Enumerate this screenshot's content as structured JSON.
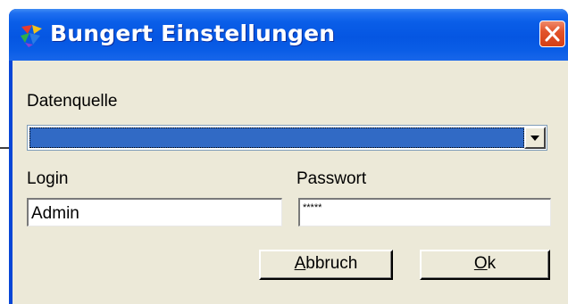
{
  "window": {
    "title": "Bungert Einstellungen",
    "app_icon": "bungert-app-icon",
    "close_icon": "close-icon"
  },
  "form": {
    "datasource_label": "Datenquelle",
    "datasource_value": "",
    "login_label": "Login",
    "login_value": "Admin",
    "password_label": "Passwort",
    "password_value": "*****"
  },
  "buttons": {
    "cancel_accel": "A",
    "cancel_rest": "bbruch",
    "ok_accel": "O",
    "ok_rest": "k"
  },
  "colors": {
    "titlebar": "#0a5ee8",
    "dialog_face": "#ece9d8",
    "selection": "#316ac5",
    "close_button": "#d53f14"
  }
}
